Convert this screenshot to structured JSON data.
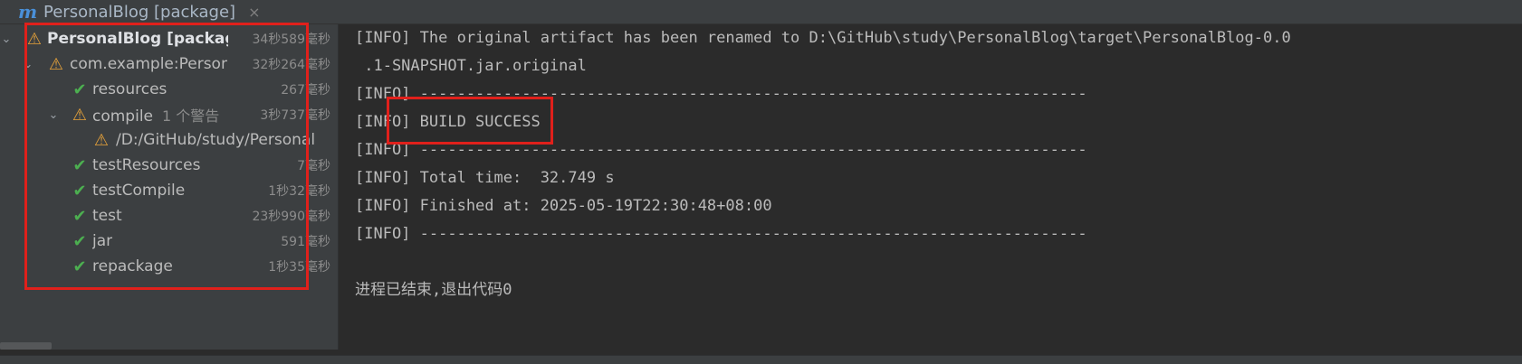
{
  "tab": {
    "title": "PersonalBlog [package]",
    "icon": "maven-icon",
    "close": "×"
  },
  "tree": [
    {
      "label": "PersonalBlog [package]",
      "time": "34秒589毫秒",
      "status": "warn",
      "expanded": true,
      "level": 0
    },
    {
      "label": "com.example:Persona",
      "time": "32秒264毫秒",
      "status": "warn",
      "expanded": true,
      "level": 1
    },
    {
      "label": "resources",
      "time": "267毫秒",
      "status": "ok",
      "level": 2
    },
    {
      "label": "compile",
      "extra": "1 个警告",
      "time": "3秒737毫秒",
      "status": "warn",
      "expanded": true,
      "level": 2
    },
    {
      "label": "/D:/GitHub/study/Personal",
      "time": "",
      "status": "warn",
      "level": 3
    },
    {
      "label": "testResources",
      "time": "7毫秒",
      "status": "ok",
      "level": 2
    },
    {
      "label": "testCompile",
      "time": "1秒32毫秒",
      "status": "ok",
      "level": 2
    },
    {
      "label": "test",
      "time": "23秒990毫秒",
      "status": "ok",
      "level": 2
    },
    {
      "label": "jar",
      "time": "591毫秒",
      "status": "ok",
      "level": 2
    },
    {
      "label": "repackage",
      "time": "1秒35毫秒",
      "status": "ok",
      "level": 2
    }
  ],
  "console": [
    "[INFO] The original artifact has been renamed to D:\\GitHub\\study\\PersonalBlog\\target\\PersonalBlog-0.0",
    " .1-SNAPSHOT.jar.original",
    "[INFO] ------------------------------------------------------------------------",
    "[INFO] BUILD SUCCESS",
    "[INFO] ------------------------------------------------------------------------",
    "[INFO] Total time:  32.749 s",
    "[INFO] Finished at: 2025-05-19T22:30:48+08:00",
    "[INFO] ------------------------------------------------------------------------",
    "",
    "进程已结束,退出代码0"
  ],
  "colors": {
    "ok": "#4caf50",
    "warn": "#e8a33a",
    "highlight": "#e0201b"
  }
}
